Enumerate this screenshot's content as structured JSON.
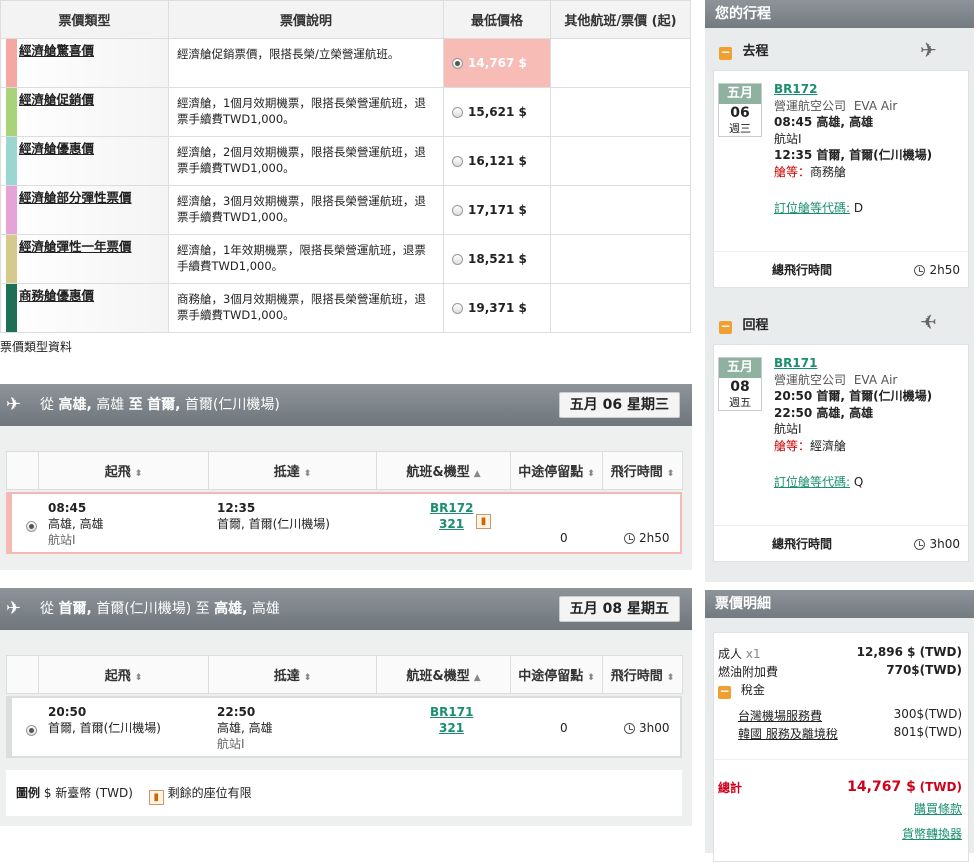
{
  "fare_table": {
    "headers": [
      "票價類型",
      "票價說明",
      "最低價格",
      "其他航班/票價 (起)"
    ],
    "rows": [
      {
        "name": "經濟艙驚喜價",
        "color": "#f4a8a2",
        "desc": "經濟艙促銷票價，限搭長榮/立榮營運航班。",
        "price": "14,767 $",
        "selected": true
      },
      {
        "name": "經濟艙促銷價",
        "color": "#a9d37a",
        "desc": "經濟艙，1個月效期機票，限搭長榮營運航班，退票手續費TWD1,000。",
        "price": "15,621 $",
        "selected": false
      },
      {
        "name": "經濟艙優惠價",
        "color": "#9cd6d0",
        "desc": "經濟艙，2個月效期機票，限搭長榮營運航班，退票手續費TWD1,000。",
        "price": "16,121 $",
        "selected": false
      },
      {
        "name": "經濟艙部分彈性票價",
        "color": "#e6a3d8",
        "desc": "經濟艙，3個月效期機票，限搭長榮營運航班，退票手續費TWD1,000。",
        "price": "17,171 $",
        "selected": false
      },
      {
        "name": "經濟艙彈性一年票價",
        "color": "#d6c98e",
        "desc": "經濟艙，1年效期機票，限搭長榮營運航班，退票手續費TWD1,000。",
        "price": "18,521 $",
        "selected": false
      },
      {
        "name": "商務艙優惠價",
        "color": "#1f6f57",
        "desc": "商務艙，3個月效期機票，限搭長榮營運航班，退票手續費TWD1,000。",
        "price": "19,371 $",
        "selected": false
      }
    ],
    "footnote": "票價類型資料"
  },
  "outbound": {
    "prefix": "從",
    "origin_bold": "高雄,",
    "origin_rest": "高雄",
    "to": "至",
    "dest_bold": "首爾,",
    "dest_rest": "首爾(仁川機場)",
    "date": "五月 06 星期三",
    "cols": [
      "起飛",
      "抵達",
      "航班&機型",
      "中途停留點",
      "飛行時間"
    ],
    "flight": {
      "dep_time": "08:45",
      "dep_city": "高雄, 高雄",
      "dep_terminal": "航站I",
      "arr_time": "12:35",
      "arr_city": "首爾, 首爾(仁川機場)",
      "flight_no": "BR172",
      "aircraft": "321",
      "stops": "0",
      "duration": "2h50"
    }
  },
  "inbound": {
    "prefix": "從",
    "origin_bold": "首爾,",
    "origin_rest": "首爾(仁川機場)",
    "to": "至",
    "dest_bold": "高雄,",
    "dest_rest": "高雄",
    "date": "五月 08 星期五",
    "cols": [
      "起飛",
      "抵達",
      "航班&機型",
      "中途停留點",
      "飛行時間"
    ],
    "flight": {
      "dep_time": "20:50",
      "dep_city": "首爾, 首爾(仁川機場)",
      "arr_time": "22:50",
      "arr_city": "高雄, 高雄",
      "arr_terminal": "航站I",
      "flight_no": "BR171",
      "aircraft": "321",
      "stops": "0",
      "duration": "3h00"
    }
  },
  "legend": {
    "title": "圖例",
    "currency": "$ 新臺幣 (TWD)",
    "seats": "剩餘的座位有限"
  },
  "itinerary": {
    "title": "您的行程",
    "out": {
      "label": "去程",
      "month": "五月",
      "day": "06",
      "weekday": "週三",
      "flight_no": "BR172",
      "operator": "營運航空公司",
      "airline": "EVA Air",
      "dep": "08:45 高雄, 高雄",
      "dep_terminal": "航站I",
      "arr": "12:35 首爾, 首爾(仁川機場)",
      "cabin_label": "艙等：",
      "cabin": "商務艙",
      "class_label": "訂位艙等代碼:",
      "class_code": "D",
      "total_label": "總飛行時間",
      "total": "2h50"
    },
    "ret": {
      "label": "回程",
      "month": "五月",
      "day": "08",
      "weekday": "週五",
      "flight_no": "BR171",
      "operator": "營運航空公司",
      "airline": "EVA Air",
      "dep": "20:50 首爾, 首爾(仁川機場)",
      "arr": "22:50 高雄, 高雄",
      "arr_terminal": "航站I",
      "cabin_label": "艙等：",
      "cabin": "經濟艙",
      "class_label": "訂位艙等代碼:",
      "class_code": "Q",
      "total_label": "總飛行時間",
      "total": "3h00"
    }
  },
  "price_detail": {
    "title": "票價明細",
    "adult_label": "成人",
    "adult_qty": "x1",
    "adult_price": "12,896 $ (TWD)",
    "fuel_label": "燃油附加費",
    "fuel_price": "770$(TWD)",
    "tax_label": "稅金",
    "tax1_label": "台灣機場服務費",
    "tax1_price": "300$(TWD)",
    "tax2_label": "韓國 服務及離境稅",
    "tax2_price": "801$(TWD)",
    "total_label": "總計",
    "total_price": "14,767 $",
    "total_currency": "(TWD)",
    "link1": "購買條款",
    "link2": "貨幣轉換器"
  }
}
